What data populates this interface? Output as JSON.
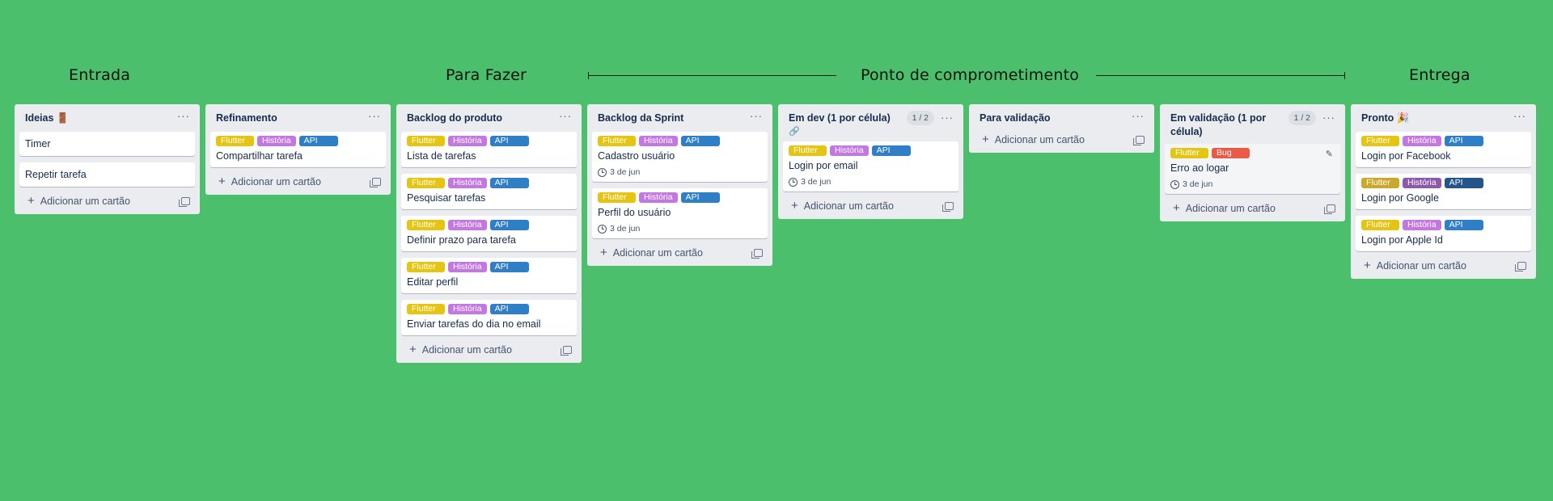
{
  "sections": {
    "entrada": "Entrada",
    "para_fazer": "Para Fazer",
    "ponto": "Ponto de comprometimento",
    "entrega": "Entrega"
  },
  "colors": {
    "background": "#4bbf6b",
    "flutter": "#e5c511",
    "historia": "#c377e0",
    "api": "#2f7fc7",
    "bug": "#eb5a46"
  },
  "add_card_label": "Adicionar um cartão",
  "lists": [
    {
      "title": "Ideias 🚪",
      "cards": [
        {
          "title": "Timer"
        },
        {
          "title": "Repetir tarefa"
        }
      ]
    },
    {
      "title": "Refinamento",
      "cards": [
        {
          "labels": [
            "Flutter",
            "História",
            "API"
          ],
          "title": "Compartilhar tarefa"
        }
      ]
    },
    {
      "title": "Backlog do produto",
      "cards": [
        {
          "labels": [
            "Flutter",
            "História",
            "API"
          ],
          "title": "Lista de tarefas"
        },
        {
          "labels": [
            "Flutter",
            "História",
            "API"
          ],
          "title": "Pesquisar tarefas"
        },
        {
          "labels": [
            "Flutter",
            "História",
            "API"
          ],
          "title": "Definir prazo para tarefa"
        },
        {
          "labels": [
            "Flutter",
            "História",
            "API"
          ],
          "title": "Editar perfil"
        },
        {
          "labels": [
            "Flutter",
            "História",
            "API"
          ],
          "title": "Enviar tarefas do dia no email"
        }
      ]
    },
    {
      "title": "Backlog da Sprint",
      "cards": [
        {
          "labels": [
            "Flutter",
            "História",
            "API"
          ],
          "title": "Cadastro usuário",
          "due": "3 de jun"
        },
        {
          "labels": [
            "Flutter",
            "História",
            "API"
          ],
          "title": "Perfil do usuário",
          "due": "3 de jun"
        }
      ]
    },
    {
      "title": "Em dev (1 por célula)",
      "limit": "1 / 2",
      "cards": [
        {
          "labels": [
            "Flutter",
            "História",
            "API"
          ],
          "title": "Login por email",
          "due": "3 de jun"
        }
      ]
    },
    {
      "title": "Para validação",
      "cards": []
    },
    {
      "title": "Em validação (1 por célula)",
      "limit": "1 / 2",
      "cards": [
        {
          "labels": [
            "Flutter",
            "Bug"
          ],
          "title": "Erro ao logar",
          "due": "3 de jun"
        }
      ]
    },
    {
      "title": "Pronto 🎉",
      "cards": [
        {
          "labels": [
            "Flutter",
            "História",
            "API"
          ],
          "title": "Login por Facebook"
        },
        {
          "labels": [
            "Flutter",
            "História",
            "API"
          ],
          "title": "Login por Google"
        },
        {
          "labels": [
            "Flutter",
            "História",
            "API"
          ],
          "title": "Login por Apple Id"
        }
      ]
    }
  ]
}
